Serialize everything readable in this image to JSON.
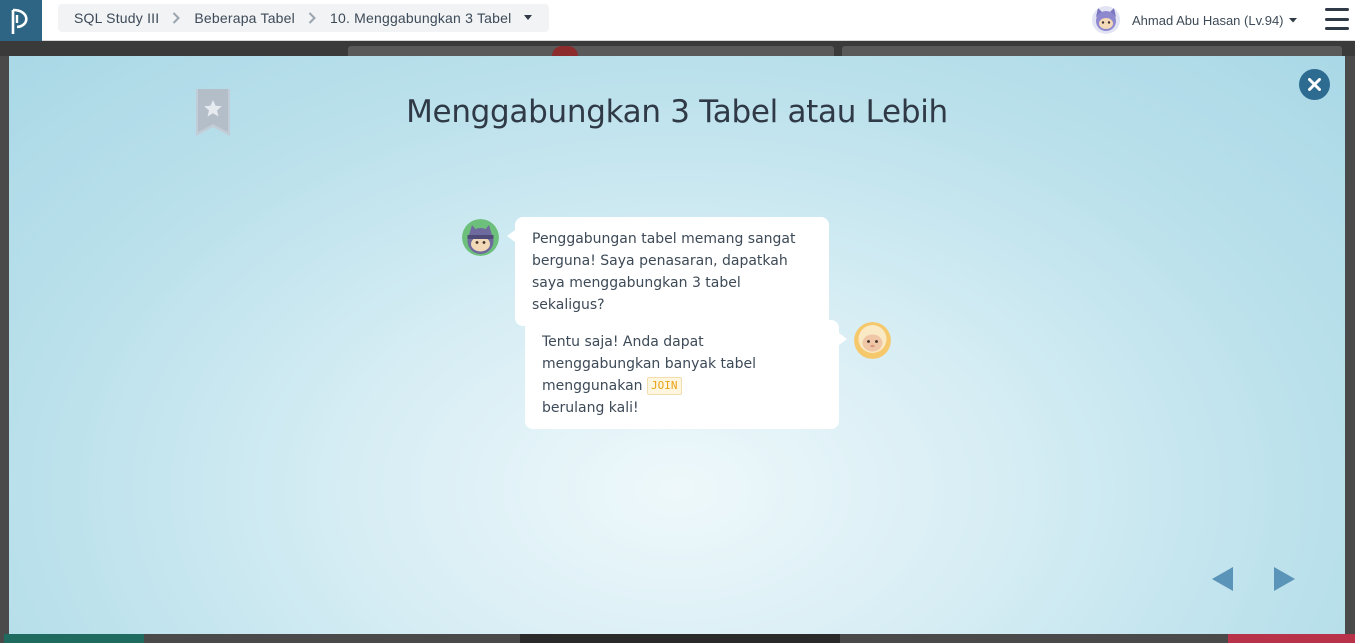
{
  "header": {
    "breadcrumb": [
      "SQL Study III",
      "Beberapa Tabel",
      "10. Menggabungkan 3 Tabel"
    ],
    "user_name": "Ahmad Abu Hasan (Lv.94)"
  },
  "modal": {
    "title": "Menggabungkan 3 Tabel atau Lebih",
    "messages": [
      {
        "side": "left",
        "text": "Penggabungan tabel memang sangat berguna! Saya penasaran, dapatkah saya menggabungkan 3 tabel sekaligus?"
      },
      {
        "side": "right",
        "text_before": "Tentu saja! Anda dapat menggabungkan banyak tabel menggunakan ",
        "code": "JOIN",
        "text_after": "berulang kali!"
      }
    ]
  },
  "colors": {
    "brand": "#2f6584",
    "close_button": "#2d6b91",
    "nav_arrow": "#5a94b8",
    "code_text": "#e8a317"
  },
  "icons": {
    "logo": "progate-logo",
    "breadcrumb_separator": "chevron-right-icon",
    "dropdown": "caret-down-icon",
    "menu": "hamburger-icon",
    "close": "close-icon",
    "bookmark": "bookmark-star-icon",
    "prev": "prev-arrow-icon",
    "next": "next-arrow-icon"
  }
}
